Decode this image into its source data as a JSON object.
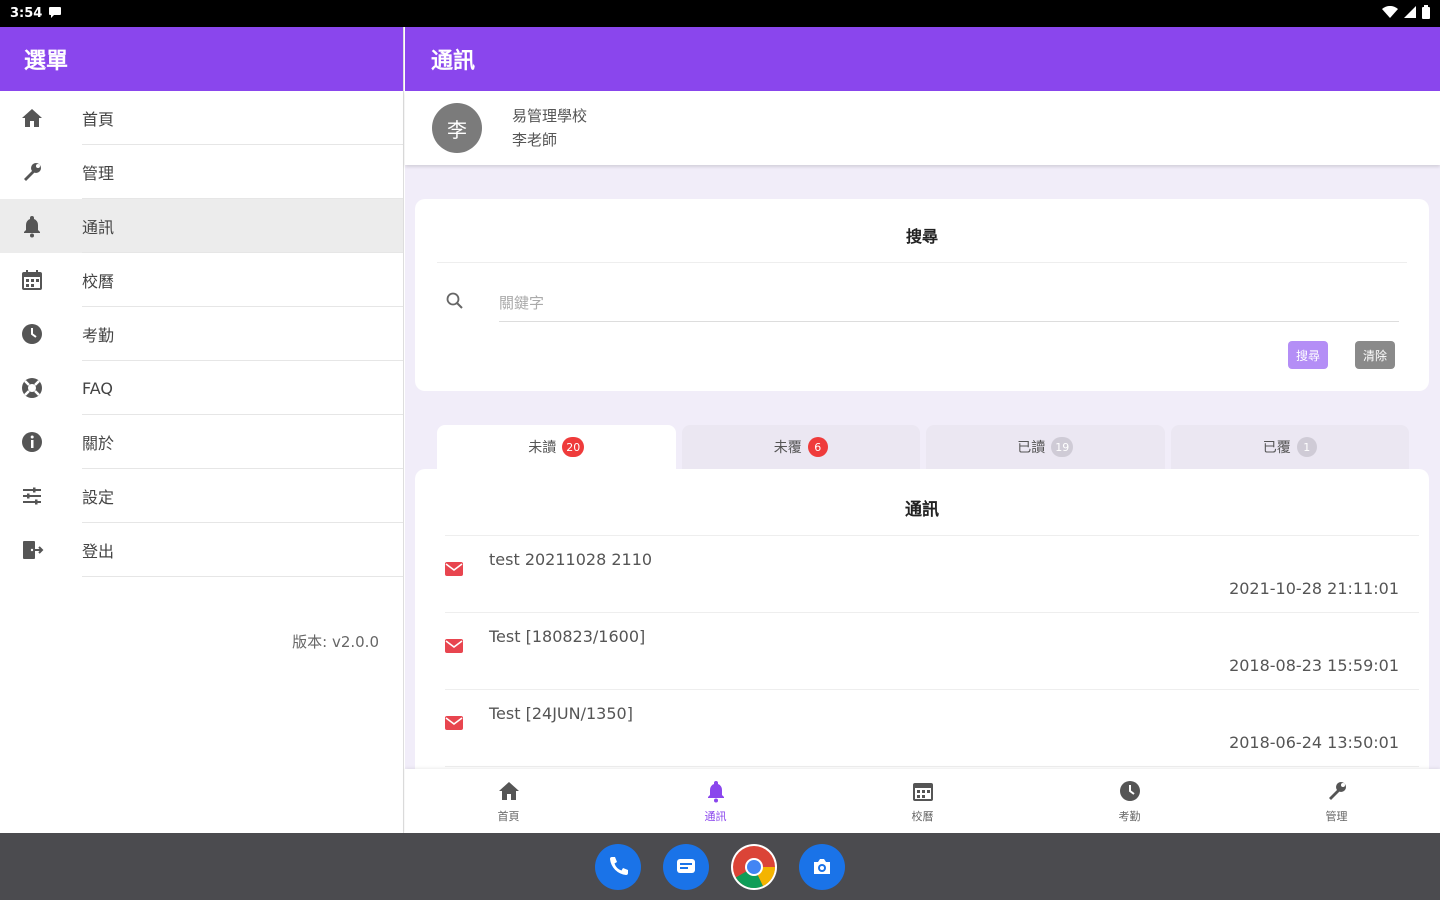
{
  "status_bar": {
    "time": "3:54"
  },
  "sidebar": {
    "title": "選單",
    "items": [
      {
        "label": "首頁",
        "icon": "home-icon"
      },
      {
        "label": "管理",
        "icon": "wrench-icon"
      },
      {
        "label": "通訊",
        "icon": "bell-icon",
        "active": true
      },
      {
        "label": "校曆",
        "icon": "calendar-icon"
      },
      {
        "label": "考勤",
        "icon": "clock-icon"
      },
      {
        "label": "FAQ",
        "icon": "lifebuoy-icon"
      },
      {
        "label": "關於",
        "icon": "info-icon"
      },
      {
        "label": "設定",
        "icon": "sliders-icon"
      },
      {
        "label": "登出",
        "icon": "logout-icon"
      }
    ],
    "version": "版本: v2.0.0"
  },
  "main": {
    "title": "通訊",
    "profile": {
      "avatar_char": "李",
      "school": "易管理學校",
      "teacher": "李老師"
    },
    "search": {
      "title": "搜尋",
      "placeholder": "關鍵字",
      "search_button": "搜尋",
      "clear_button": "清除"
    },
    "tabs": [
      {
        "label": "未讀",
        "count": "20",
        "badge": "red",
        "active": true
      },
      {
        "label": "未覆",
        "count": "6",
        "badge": "red"
      },
      {
        "label": "已讀",
        "count": "19",
        "badge": "grey"
      },
      {
        "label": "已覆",
        "count": "1",
        "badge": "grey"
      }
    ],
    "list": {
      "title": "通訊",
      "messages": [
        {
          "title": "test 20211028 2110",
          "time": "2021-10-28 21:11:01"
        },
        {
          "title": "Test [180823/1600]",
          "time": "2018-08-23 15:59:01"
        },
        {
          "title": "Test [24JUN/1350]",
          "time": "2018-06-24 13:50:01"
        }
      ]
    },
    "bottom_nav": [
      {
        "label": "首頁",
        "icon": "home-icon"
      },
      {
        "label": "通訊",
        "icon": "bell-icon",
        "active": true
      },
      {
        "label": "校曆",
        "icon": "calendar-icon"
      },
      {
        "label": "考勤",
        "icon": "clock-icon"
      },
      {
        "label": "管理",
        "icon": "wrench-icon"
      }
    ]
  },
  "dock": [
    "phone-icon",
    "messages-icon",
    "chrome-icon",
    "camera-icon"
  ],
  "colors": {
    "accent": "#8a46ed",
    "badge_red": "#ef3b3b",
    "mail_red": "#e8454f"
  }
}
